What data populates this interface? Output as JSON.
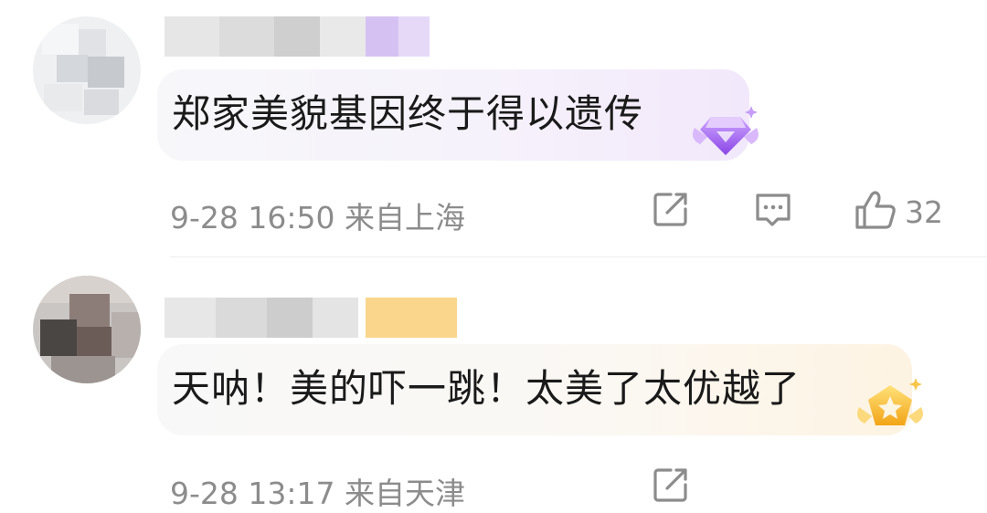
{
  "comments": [
    {
      "text": "郑家美貌基因终于得以遗传",
      "time": "9-28 16:50",
      "location": "来自上海",
      "likes": "32",
      "badge_icon": "purple-diamond-badge-icon",
      "colors": {
        "badge": "#a66cf0"
      }
    },
    {
      "text": "天呐！美的吓一跳！太美了太优越了",
      "time": "9-28 13:17",
      "location": "来自天津",
      "badge_icon": "gold-star-badge-icon",
      "colors": {
        "badge": "#f3b21d"
      }
    }
  ],
  "icons": {
    "share": "share-icon",
    "reply": "comment-icon",
    "like": "thumbs-up-icon"
  }
}
